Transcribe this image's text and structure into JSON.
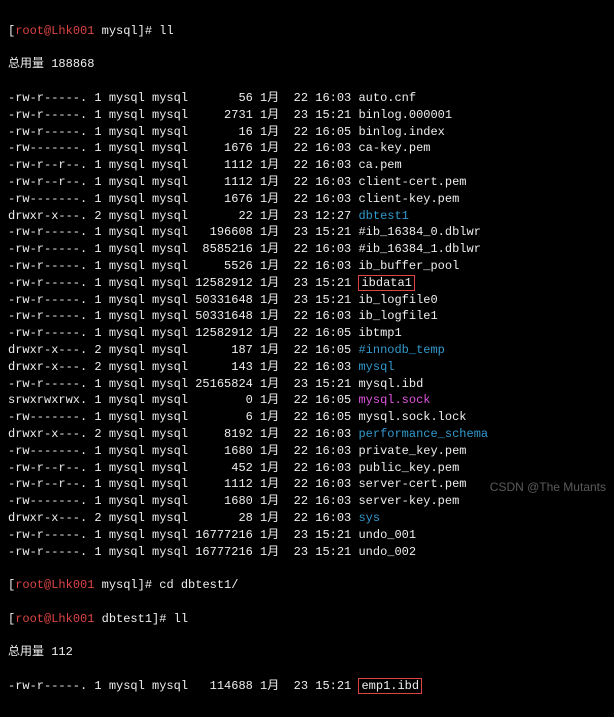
{
  "prompt1": {
    "userhost": "root@Lhk001",
    "dir": "mysql",
    "cmd": "ll"
  },
  "total1_label": "总用量",
  "total1_value": "188868",
  "rows": [
    {
      "perm": "-rw-r-----.",
      "n": "1",
      "o": "mysql",
      "g": "mysql",
      "size": "      56",
      "mon": "1月",
      "day": "22",
      "time": "16:03",
      "name": "auto.cnf",
      "cls": "white"
    },
    {
      "perm": "-rw-r-----.",
      "n": "1",
      "o": "mysql",
      "g": "mysql",
      "size": "    2731",
      "mon": "1月",
      "day": "23",
      "time": "15:21",
      "name": "binlog.000001",
      "cls": "white"
    },
    {
      "perm": "-rw-r-----.",
      "n": "1",
      "o": "mysql",
      "g": "mysql",
      "size": "      16",
      "mon": "1月",
      "day": "22",
      "time": "16:05",
      "name": "binlog.index",
      "cls": "white"
    },
    {
      "perm": "-rw-------.",
      "n": "1",
      "o": "mysql",
      "g": "mysql",
      "size": "    1676",
      "mon": "1月",
      "day": "22",
      "time": "16:03",
      "name": "ca-key.pem",
      "cls": "white"
    },
    {
      "perm": "-rw-r--r--.",
      "n": "1",
      "o": "mysql",
      "g": "mysql",
      "size": "    1112",
      "mon": "1月",
      "day": "22",
      "time": "16:03",
      "name": "ca.pem",
      "cls": "white"
    },
    {
      "perm": "-rw-r--r--.",
      "n": "1",
      "o": "mysql",
      "g": "mysql",
      "size": "    1112",
      "mon": "1月",
      "day": "22",
      "time": "16:03",
      "name": "client-cert.pem",
      "cls": "white"
    },
    {
      "perm": "-rw-------.",
      "n": "1",
      "o": "mysql",
      "g": "mysql",
      "size": "    1676",
      "mon": "1月",
      "day": "22",
      "time": "16:03",
      "name": "client-key.pem",
      "cls": "white"
    },
    {
      "perm": "drwxr-x---.",
      "n": "2",
      "o": "mysql",
      "g": "mysql",
      "size": "      22",
      "mon": "1月",
      "day": "23",
      "time": "12:27",
      "name": "dbtest1",
      "cls": "blue"
    },
    {
      "perm": "-rw-r-----.",
      "n": "1",
      "o": "mysql",
      "g": "mysql",
      "size": "  196608",
      "mon": "1月",
      "day": "23",
      "time": "15:21",
      "name": "#ib_16384_0.dblwr",
      "cls": "white"
    },
    {
      "perm": "-rw-r-----.",
      "n": "1",
      "o": "mysql",
      "g": "mysql",
      "size": " 8585216",
      "mon": "1月",
      "day": "22",
      "time": "16:03",
      "name": "#ib_16384_1.dblwr",
      "cls": "white"
    },
    {
      "perm": "-rw-r-----.",
      "n": "1",
      "o": "mysql",
      "g": "mysql",
      "size": "    5526",
      "mon": "1月",
      "day": "22",
      "time": "16:03",
      "name": "ib_buffer_pool",
      "cls": "white"
    },
    {
      "perm": "-rw-r-----.",
      "n": "1",
      "o": "mysql",
      "g": "mysql",
      "size": "12582912",
      "mon": "1月",
      "day": "23",
      "time": "15:21",
      "name": "ibdata1",
      "cls": "white",
      "boxed": true
    },
    {
      "perm": "-rw-r-----.",
      "n": "1",
      "o": "mysql",
      "g": "mysql",
      "size": "50331648",
      "mon": "1月",
      "day": "23",
      "time": "15:21",
      "name": "ib_logfile0",
      "cls": "white"
    },
    {
      "perm": "-rw-r-----.",
      "n": "1",
      "o": "mysql",
      "g": "mysql",
      "size": "50331648",
      "mon": "1月",
      "day": "22",
      "time": "16:03",
      "name": "ib_logfile1",
      "cls": "white"
    },
    {
      "perm": "-rw-r-----.",
      "n": "1",
      "o": "mysql",
      "g": "mysql",
      "size": "12582912",
      "mon": "1月",
      "day": "22",
      "time": "16:05",
      "name": "ibtmp1",
      "cls": "white"
    },
    {
      "perm": "drwxr-x---.",
      "n": "2",
      "o": "mysql",
      "g": "mysql",
      "size": "     187",
      "mon": "1月",
      "day": "22",
      "time": "16:05",
      "name": "#innodb_temp",
      "cls": "blue"
    },
    {
      "perm": "drwxr-x---.",
      "n": "2",
      "o": "mysql",
      "g": "mysql",
      "size": "     143",
      "mon": "1月",
      "day": "22",
      "time": "16:03",
      "name": "mysql",
      "cls": "blue"
    },
    {
      "perm": "-rw-r-----.",
      "n": "1",
      "o": "mysql",
      "g": "mysql",
      "size": "25165824",
      "mon": "1月",
      "day": "23",
      "time": "15:21",
      "name": "mysql.ibd",
      "cls": "white"
    },
    {
      "perm": "srwxrwxrwx.",
      "n": "1",
      "o": "mysql",
      "g": "mysql",
      "size": "       0",
      "mon": "1月",
      "day": "22",
      "time": "16:05",
      "name": "mysql.sock",
      "cls": "magenta"
    },
    {
      "perm": "-rw-------.",
      "n": "1",
      "o": "mysql",
      "g": "mysql",
      "size": "       6",
      "mon": "1月",
      "day": "22",
      "time": "16:05",
      "name": "mysql.sock.lock",
      "cls": "white"
    },
    {
      "perm": "drwxr-x---.",
      "n": "2",
      "o": "mysql",
      "g": "mysql",
      "size": "    8192",
      "mon": "1月",
      "day": "22",
      "time": "16:03",
      "name": "performance_schema",
      "cls": "blue"
    },
    {
      "perm": "-rw-------.",
      "n": "1",
      "o": "mysql",
      "g": "mysql",
      "size": "    1680",
      "mon": "1月",
      "day": "22",
      "time": "16:03",
      "name": "private_key.pem",
      "cls": "white"
    },
    {
      "perm": "-rw-r--r--.",
      "n": "1",
      "o": "mysql",
      "g": "mysql",
      "size": "     452",
      "mon": "1月",
      "day": "22",
      "time": "16:03",
      "name": "public_key.pem",
      "cls": "white"
    },
    {
      "perm": "-rw-r--r--.",
      "n": "1",
      "o": "mysql",
      "g": "mysql",
      "size": "    1112",
      "mon": "1月",
      "day": "22",
      "time": "16:03",
      "name": "server-cert.pem",
      "cls": "white"
    },
    {
      "perm": "-rw-------.",
      "n": "1",
      "o": "mysql",
      "g": "mysql",
      "size": "    1680",
      "mon": "1月",
      "day": "22",
      "time": "16:03",
      "name": "server-key.pem",
      "cls": "white"
    },
    {
      "perm": "drwxr-x---.",
      "n": "2",
      "o": "mysql",
      "g": "mysql",
      "size": "      28",
      "mon": "1月",
      "day": "22",
      "time": "16:03",
      "name": "sys",
      "cls": "blue"
    },
    {
      "perm": "-rw-r-----.",
      "n": "1",
      "o": "mysql",
      "g": "mysql",
      "size": "16777216",
      "mon": "1月",
      "day": "23",
      "time": "15:21",
      "name": "undo_001",
      "cls": "white"
    },
    {
      "perm": "-rw-r-----.",
      "n": "1",
      "o": "mysql",
      "g": "mysql",
      "size": "16777216",
      "mon": "1月",
      "day": "23",
      "time": "15:21",
      "name": "undo_002",
      "cls": "white"
    }
  ],
  "prompt2": {
    "userhost": "root@Lhk001",
    "dir": "mysql",
    "cmd": "cd dbtest1/"
  },
  "prompt3": {
    "userhost": "root@Lhk001",
    "dir": "dbtest1",
    "cmd": "ll"
  },
  "total2_label": "总用量",
  "total2_value": "112",
  "rows2": [
    {
      "perm": "-rw-r-----.",
      "n": "1",
      "o": "mysql",
      "g": "mysql",
      "size": "  114688",
      "mon": "1月",
      "day": "23",
      "time": "15:21",
      "name": "emp1.ibd",
      "cls": "white",
      "boxed": true
    }
  ],
  "watermark": "CSDN @The Mutants"
}
